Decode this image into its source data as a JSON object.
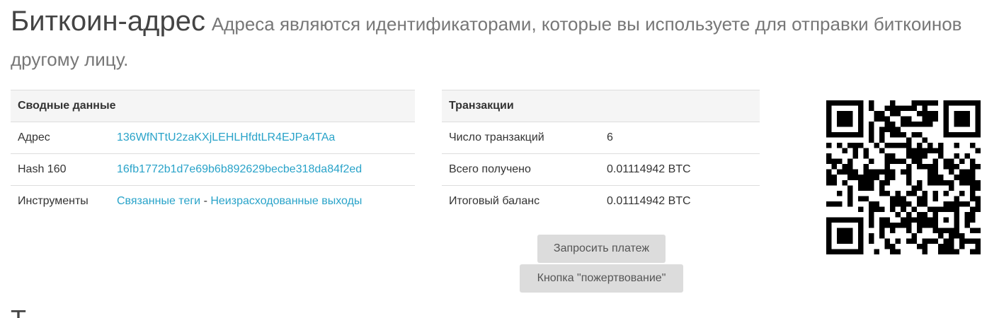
{
  "heading": {
    "title": "Биткоин-адрес",
    "subtitle": "Адреса являются идентификаторами, которые вы используете для отправки биткоинов другому лицу."
  },
  "summary": {
    "header": "Сводные данные",
    "address_label": "Адрес",
    "address_value": "136WfNTtU2zaKXjLEHLHfdtLR4EJPa4TAa",
    "hash_label": "Hash 160",
    "hash_value": "16fb1772b1d7e69b6b892629becbe318da84f2ed",
    "tools_label": "Инструменты",
    "tools_link1": "Связанные теги",
    "tools_separator": "-",
    "tools_link2": "Неизрасходованные выходы"
  },
  "transactions": {
    "header": "Транзакции",
    "count_label": "Число транзакций",
    "count_value": "6",
    "received_label": "Всего получено",
    "received_value": "0.01114942 BTC",
    "balance_label": "Итоговый баланс",
    "balance_value": "0.01114942 BTC"
  },
  "buttons": {
    "request": "Запросить платеж",
    "donate": "Кнопка \"пожертвование\""
  },
  "next_heading": "Т",
  "colors": {
    "link": "#29a3c9",
    "amount": "#1e7e1e",
    "button_bg": "#dcdcdc"
  }
}
